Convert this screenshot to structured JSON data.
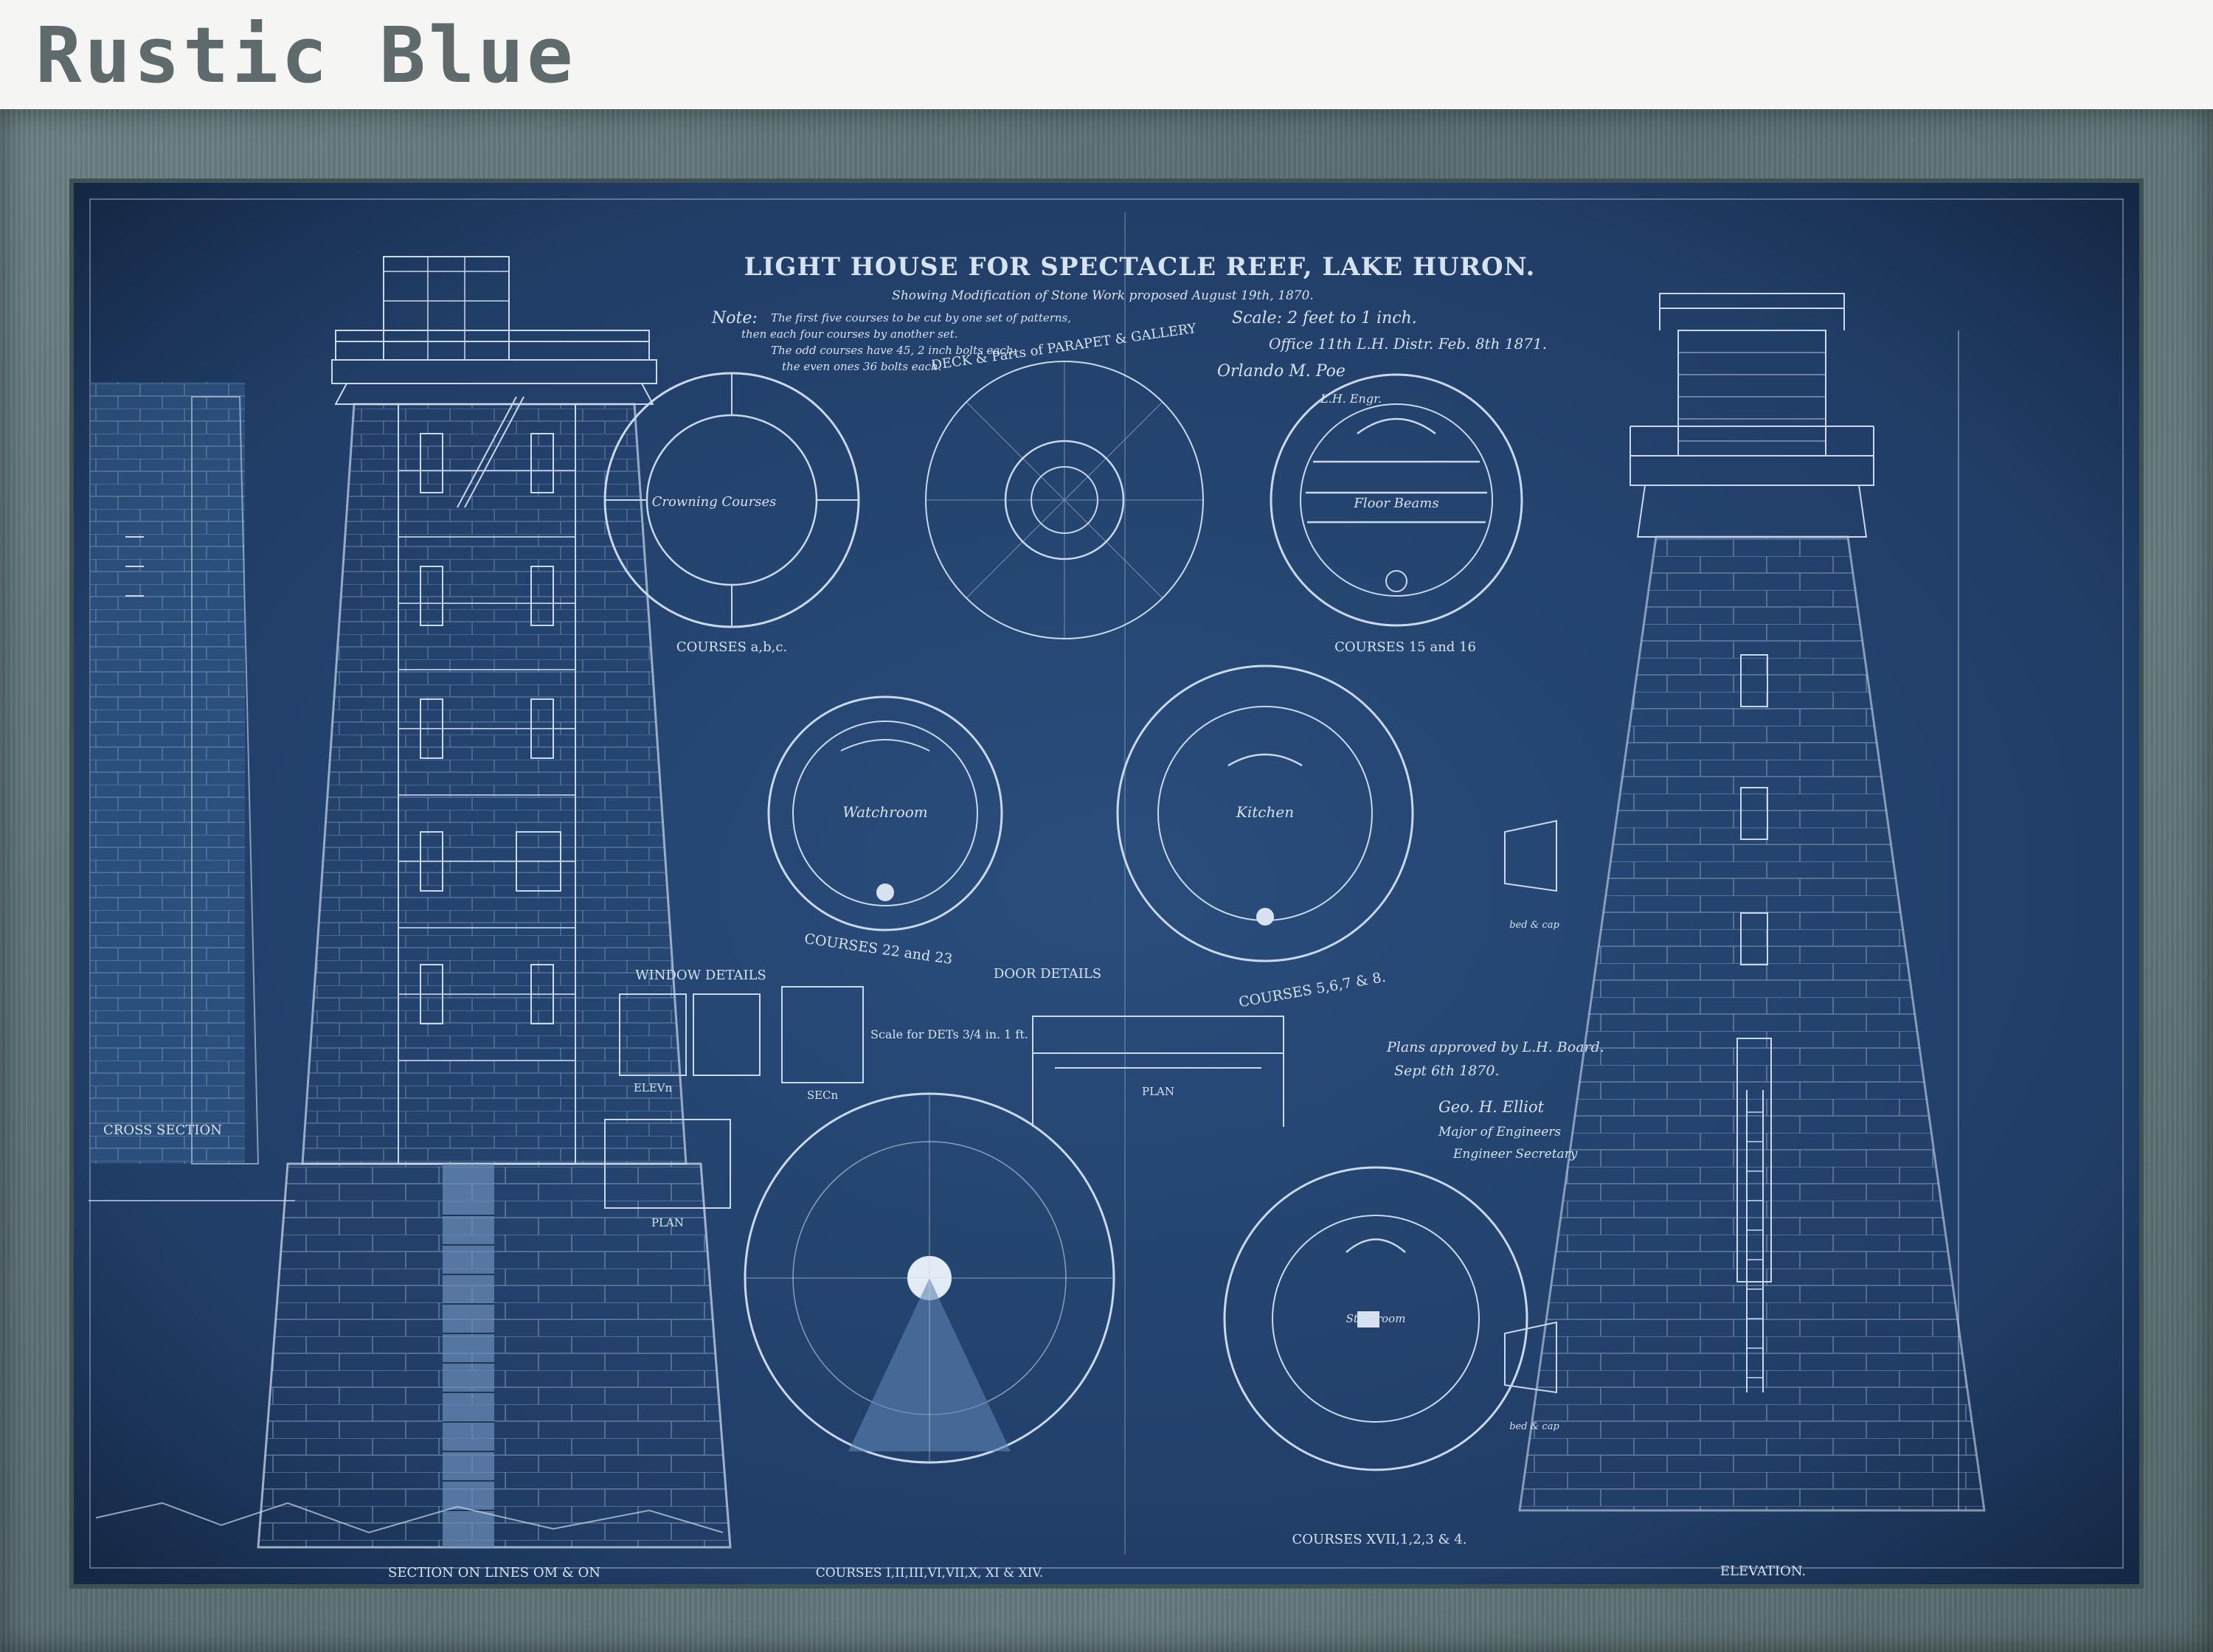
{
  "brand": {
    "name": "Rustic Blue"
  },
  "blueprint": {
    "title": "LIGHT HOUSE FOR SPECTACLE REEF, LAKE HURON.",
    "subtitle": "Showing Modification of Stone Work proposed August 19th, 1870.",
    "scale": "Scale: 2 feet to 1 inch.",
    "office": "Office 11th L.H. Distr. Feb. 8th 1871.",
    "engineer": "L.H. Engr.",
    "note": {
      "label": "Note:",
      "lines": [
        "The first five courses to be cut by one set of patterns,",
        "then each four courses by another set.",
        "The odd courses have 45, 2 inch bolts each,",
        "the even ones 36 bolts each."
      ]
    },
    "captions": {
      "courses_abc": "COURSES a,b,c.",
      "deck": "DECK & Parts of PARAPET & GALLERY",
      "courses_15_16": "COURSES 15 and 16",
      "courses_22_23": "COURSES 22 and 23",
      "courses_5678": "COURSES 5,6,7 & 8.",
      "window_details": "WINDOW DETAILS",
      "door_details": "DOOR DETAILS",
      "scale_details": "Scale for DETs 3/4 in. 1 ft.",
      "elev": "ELEVn",
      "sec": "SECn",
      "plan": "PLAN",
      "cross_section": "CROSS SECTION",
      "section_lines": "SECTION ON LINES OM & ON",
      "courses_large": "COURSES I,II,III,VI,VII,X, XI & XIV.",
      "courses_17": "COURSES XVII,1,2,3 & 4.",
      "elevation": "ELEVATION.",
      "crowning": "Crowning Courses",
      "watchroom": "Watchroom",
      "kitchen": "Kitchen",
      "floor_beams": "Floor Beams",
      "storeroom": "Storeroom",
      "bed_cap": "bed & cap"
    },
    "approval": [
      "Plans approved by L.H. Board.",
      "Sept 6th 1870.",
      "Geo. H. Elliot",
      "Major of Engineers",
      "Engineer Secretary"
    ],
    "signature": "Orlando M. Poe"
  }
}
